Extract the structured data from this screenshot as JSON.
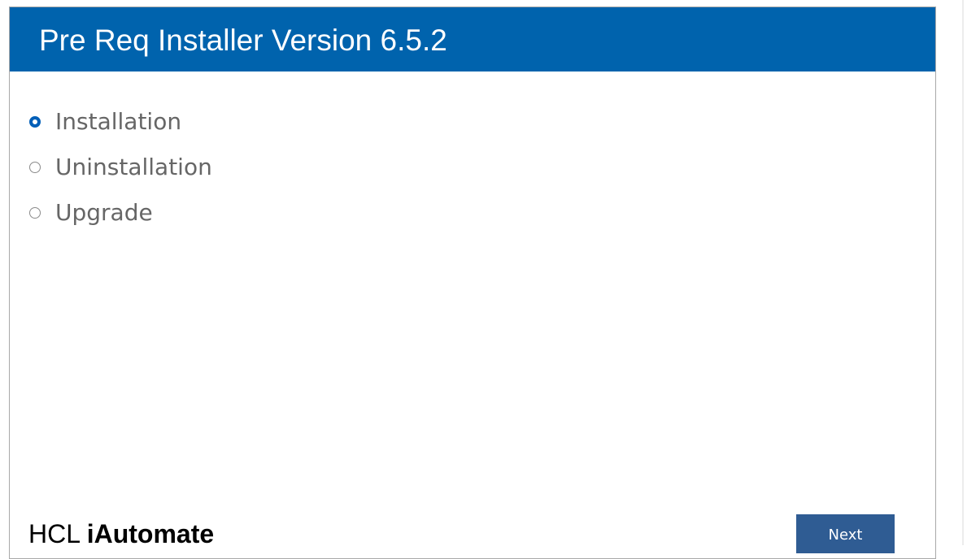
{
  "window": {
    "title": "Pre Req Installer Version 6.5.2"
  },
  "options": {
    "selected": "installation",
    "items": [
      {
        "id": "installation",
        "label": "Installation",
        "checked": true
      },
      {
        "id": "uninstallation",
        "label": "Uninstallation",
        "checked": false
      },
      {
        "id": "upgrade",
        "label": "Upgrade",
        "checked": false
      }
    ]
  },
  "footer": {
    "brand_prefix": "HCL",
    "brand_name": "iAutomate",
    "next_label": "Next"
  },
  "colors": {
    "titlebar": "#0063ad",
    "button": "#2f5c93",
    "radio_selected": "#005fb8",
    "option_text": "#666666"
  }
}
